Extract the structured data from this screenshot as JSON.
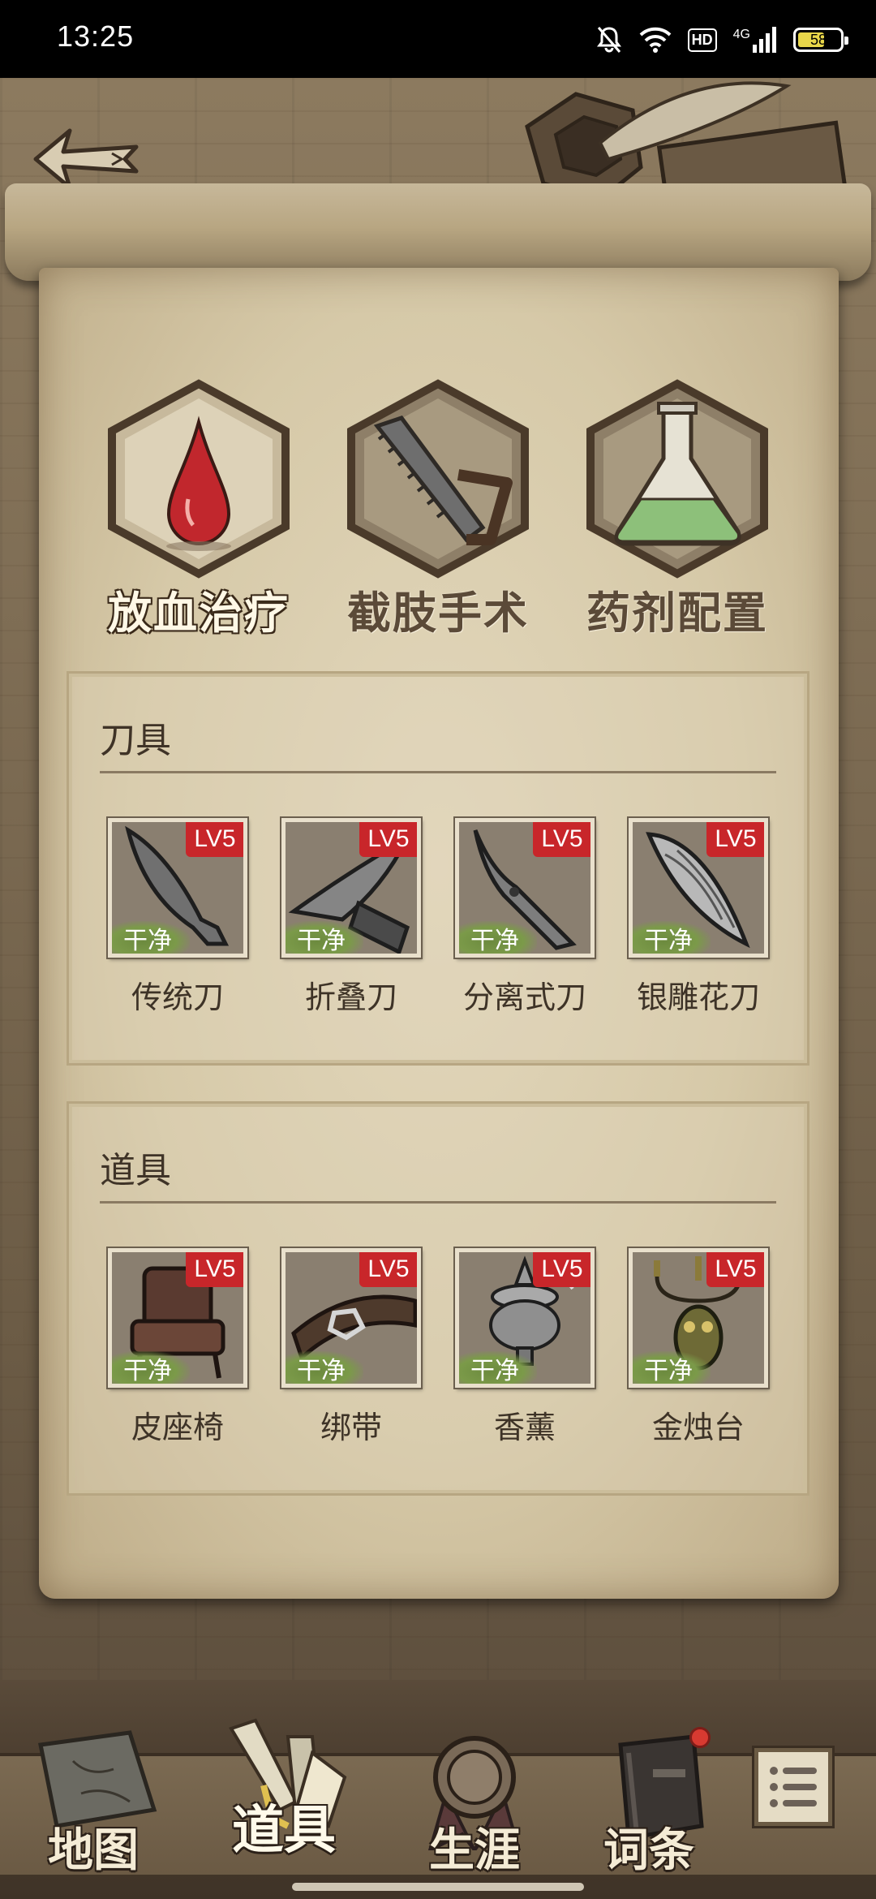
{
  "status_bar": {
    "time": "13:25",
    "battery": "58",
    "network": "4G",
    "hd_badge": "HD"
  },
  "categories": [
    {
      "label": "放血治疗",
      "icon": "blood-drop-icon",
      "active": true
    },
    {
      "label": "截肢手术",
      "icon": "saw-icon",
      "active": false
    },
    {
      "label": "药剂配置",
      "icon": "flask-icon",
      "active": false
    }
  ],
  "panels": {
    "knives": {
      "title": "刀具",
      "items": [
        {
          "name": "传统刀",
          "level": "LV5",
          "status": "干净",
          "icon": "traditional-knife-icon"
        },
        {
          "name": "折叠刀",
          "level": "LV5",
          "status": "干净",
          "icon": "folding-knife-icon"
        },
        {
          "name": "分离式刀",
          "level": "LV5",
          "status": "干净",
          "icon": "separating-knife-icon"
        },
        {
          "name": "银雕花刀",
          "level": "LV5",
          "status": "干净",
          "icon": "silver-carved-knife-icon"
        }
      ]
    },
    "tools": {
      "title": "道具",
      "items": [
        {
          "name": "皮座椅",
          "level": "LV5",
          "status": "干净",
          "icon": "leather-chair-icon"
        },
        {
          "name": "绑带",
          "level": "LV5",
          "status": "干净",
          "icon": "strap-icon"
        },
        {
          "name": "香薰",
          "level": "LV5",
          "status": "干净",
          "icon": "incense-burner-icon"
        },
        {
          "name": "金烛台",
          "level": "LV5",
          "status": "干净",
          "icon": "gold-candlestick-icon"
        }
      ]
    }
  },
  "bottom_nav": [
    {
      "label": "地图",
      "icon": "map-icon",
      "active": false
    },
    {
      "label": "道具",
      "icon": "tools-icon",
      "active": true
    },
    {
      "label": "生涯",
      "icon": "medal-icon",
      "active": false
    },
    {
      "label": "词条",
      "icon": "book-icon",
      "active": false,
      "notification": true
    }
  ],
  "colors": {
    "level_badge": "#c8262a",
    "clean_badge": "#7b9a49",
    "parchment": "#d6c9a8"
  }
}
